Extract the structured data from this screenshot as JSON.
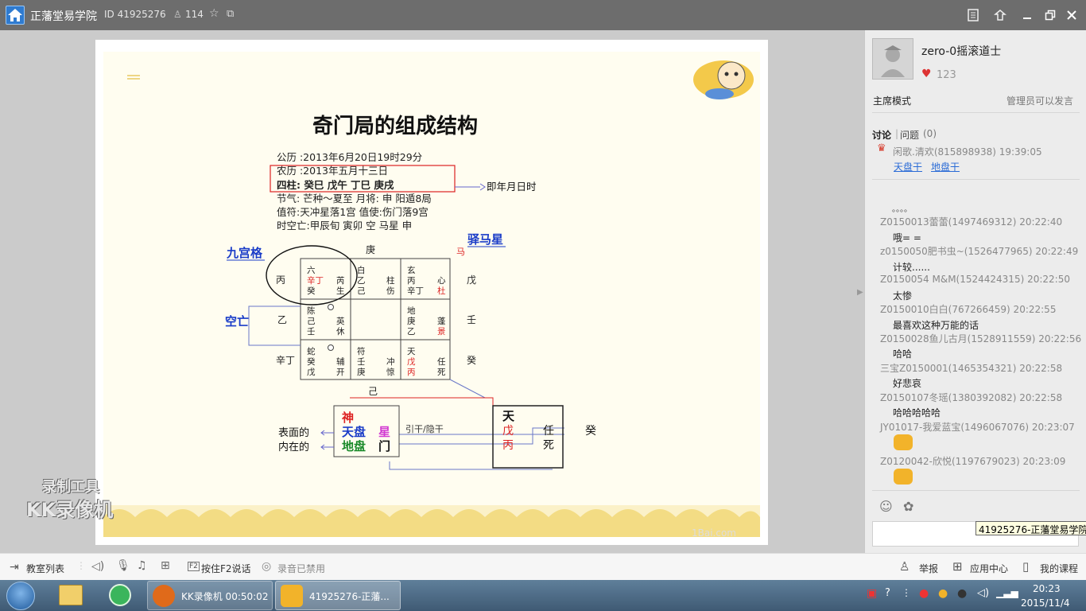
{
  "window": {
    "title": "正藩堂易学院",
    "room_id": "ID 41925276",
    "member_count": "114"
  },
  "host": {
    "name": "zero-0摇滚道士",
    "likes": "123",
    "mode": "主席模式",
    "permission": "管理员可以发言"
  },
  "tabs": {
    "discussion": "讨论",
    "questions": "问题",
    "question_count": "(0)"
  },
  "pinned": {
    "user": "闲歌.清欢(815898938) 19:39:05",
    "link1": "天盘干",
    "link2": "地盘干"
  },
  "chat": [
    {
      "user": "Z0150013蕾蕾(1497469312) 20:22:40",
      "text": "哦= ="
    },
    {
      "user": "z0150050肥书虫~(1526477965) 20:22:49",
      "text": "计较......"
    },
    {
      "user": "Z0150054 M&M(1524424315) 20:22:50",
      "text": "太惨"
    },
    {
      "user": "Z0150010白白(767266459) 20:22:55",
      "text": "最喜欢这种万能的话"
    },
    {
      "user": "Z0150028鱼儿古月(1528911559) 20:22:56",
      "text": "哈哈"
    },
    {
      "user": "三宝Z0150001(1465354321) 20:22:58",
      "text": "好悲哀"
    },
    {
      "user": "Z0150107冬瑶(1380392082) 20:22:58",
      "text": "哈哈哈哈哈"
    },
    {
      "user": "JY01017-我爱蓝宝(1496067076) 20:23:07",
      "text": ""
    },
    {
      "user": "Z0120042-欣悦(1197679023) 20:23:09",
      "text": ""
    }
  ],
  "chat_dots": "。。。。",
  "tooltip": "41925276-正藩堂易学院",
  "toolbar": {
    "classroom_list": "教室列表",
    "push_to_talk": "按住F2说话",
    "record_disabled": "录音已禁用",
    "report": "举报",
    "app_center": "应用中心",
    "my_courses": "我的课程"
  },
  "watermark": {
    "line1": "录制工具",
    "line2": "KK录像机"
  },
  "taskbar": {
    "kk_recorder": "KK录像机 00:50:02",
    "room_window": "41925276-正藩...",
    "time": "20:23",
    "date": "2015/11/4"
  },
  "slide": {
    "title": "奇门局的组成结构",
    "info": [
      "公历 :2013年6月20日19时29分",
      "农历 :2013年五月十三日",
      "四柱: 癸巳  戊午  丁巳  庚戌",
      "节气: 芒种～夏至     月将: 申  阳遁8局",
      "值符:天冲星落1宫  值使:伤门落9宫",
      "时空亡:甲辰旬  寅卯 空  马星  申"
    ],
    "arrow_note": "即年月日时",
    "label_jiugong": "九宫格",
    "label_kongwang": "空亡",
    "label_yima": "驿马星",
    "label_ma": "马",
    "outer": {
      "top": "庚",
      "left_top": "丙",
      "left_mid": "乙",
      "left_bot": "辛丁",
      "right_top": "戊",
      "right_mid": "壬",
      "right_bot": "癸",
      "bottom": "己"
    },
    "cells": {
      "c00": [
        "六",
        "辛丁",
        "芮",
        "癸",
        "生"
      ],
      "c01": [
        "白",
        "乙",
        "柱",
        "己",
        "伤"
      ],
      "c02": [
        "玄",
        "丙",
        "心",
        "辛丁",
        "杜"
      ],
      "c10": [
        "陈",
        "己",
        "英",
        "壬",
        "休"
      ],
      "c12": [
        "地",
        "庚",
        "蓬",
        "乙",
        "景"
      ],
      "c20": [
        "蛇",
        "癸",
        "辅",
        "戊",
        "开"
      ],
      "c21": [
        "符",
        "壬",
        "冲",
        "庚",
        "惊"
      ],
      "c22": [
        "天",
        "戊",
        "任",
        "丙",
        "死"
      ]
    },
    "legend": {
      "shen": "神",
      "tianpan": "天盘",
      "dipan": "地盘",
      "xing": "星",
      "men": "门",
      "yingan": "引干/隐干",
      "surface": "表面的",
      "inner": "内在的"
    },
    "example": {
      "tian": "天",
      "wu": "戊",
      "bing": "丙",
      "ren": "任",
      "si": "死",
      "gui": "癸"
    },
    "footer_watermark": "1Bai.com"
  }
}
